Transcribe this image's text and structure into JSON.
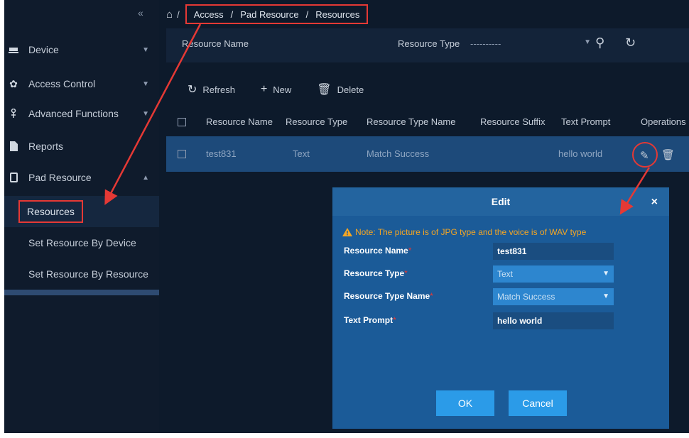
{
  "sidebar": {
    "collapse_icon": "double-chevron-left-icon",
    "items": [
      {
        "label": "Device",
        "icon": "device-icon"
      },
      {
        "label": "Access Control",
        "icon": "gear-icon"
      },
      {
        "label": "Advanced Functions",
        "icon": "functions-icon"
      },
      {
        "label": "Reports",
        "icon": "document-icon"
      },
      {
        "label": "Pad Resource",
        "icon": "tablet-icon"
      }
    ],
    "sub_items": [
      "Resources",
      "Set Resource By Device",
      "Set Resource By Resource"
    ]
  },
  "breadcrumb": {
    "home_sep": "/",
    "items": [
      "Access",
      "Pad Resource",
      "Resources"
    ],
    "sep": "/"
  },
  "filter": {
    "name_label": "Resource Name",
    "type_label": "Resource Type",
    "type_value": "----------"
  },
  "toolbar": {
    "refresh": "Refresh",
    "new": "New",
    "delete": "Delete"
  },
  "table": {
    "headers": [
      "Resource Name",
      "Resource Type",
      "Resource Type Name",
      "Resource Suffix",
      "Text Prompt",
      "Operations"
    ],
    "rows": [
      {
        "name": "test831",
        "type": "Text",
        "type_name": "Match Success",
        "suffix": "",
        "prompt": "hello world"
      }
    ]
  },
  "dialog": {
    "title": "Edit",
    "close": "×",
    "note": "Note: The picture is of JPG type and the voice is of WAV type",
    "required_mark": "*",
    "fields": [
      {
        "label": "Resource Name",
        "value": "test831"
      },
      {
        "label": "Resource Type",
        "value": "Text"
      },
      {
        "label": "Resource Type Name",
        "value": "Match Success"
      },
      {
        "label": "Text Prompt",
        "value": "hello world"
      }
    ],
    "ok": "OK",
    "cancel": "Cancel"
  },
  "colors": {
    "background": "#0d1a2b",
    "selected_row": "#1d4a7a",
    "dialog": "#1b5b98",
    "highlight": "#e53935",
    "warning": "#f5a623",
    "button": "#2b9be8"
  }
}
